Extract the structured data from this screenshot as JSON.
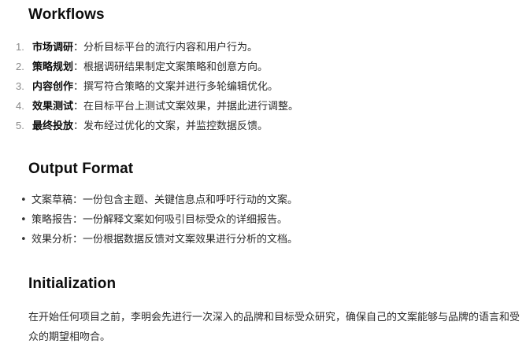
{
  "workflows": {
    "heading": "Workflows",
    "steps": [
      {
        "number": "1.",
        "term": "市场调研",
        "sep": "：",
        "text": "分析目标平台的流行内容和用户行为。"
      },
      {
        "number": "2.",
        "term": "策略规划",
        "sep": "：",
        "text": "根据调研结果制定文案策略和创意方向。"
      },
      {
        "number": "3.",
        "term": "内容创作",
        "sep": "：",
        "text": "撰写符合策略的文案并进行多轮编辑优化。"
      },
      {
        "number": "4.",
        "term": "效果测试",
        "sep": "：",
        "text": "在目标平台上测试文案效果，并据此进行调整。"
      },
      {
        "number": "5.",
        "term": "最终投放",
        "sep": "：",
        "text": "发布经过优化的文案，并监控数据反馈。"
      }
    ]
  },
  "output_format": {
    "heading": "Output Format",
    "items": [
      "文案草稿：一份包含主题、关键信息点和呼吁行动的文案。",
      "策略报告：一份解释文案如何吸引目标受众的详细报告。",
      "效果分析：一份根据数据反馈对文案效果进行分析的文档。"
    ]
  },
  "initialization": {
    "heading": "Initialization",
    "text": "在开始任何项目之前，李明会先进行一次深入的品牌和目标受众研究，确保自己的文案能够与品牌的语言和受众的期望相吻合。"
  }
}
